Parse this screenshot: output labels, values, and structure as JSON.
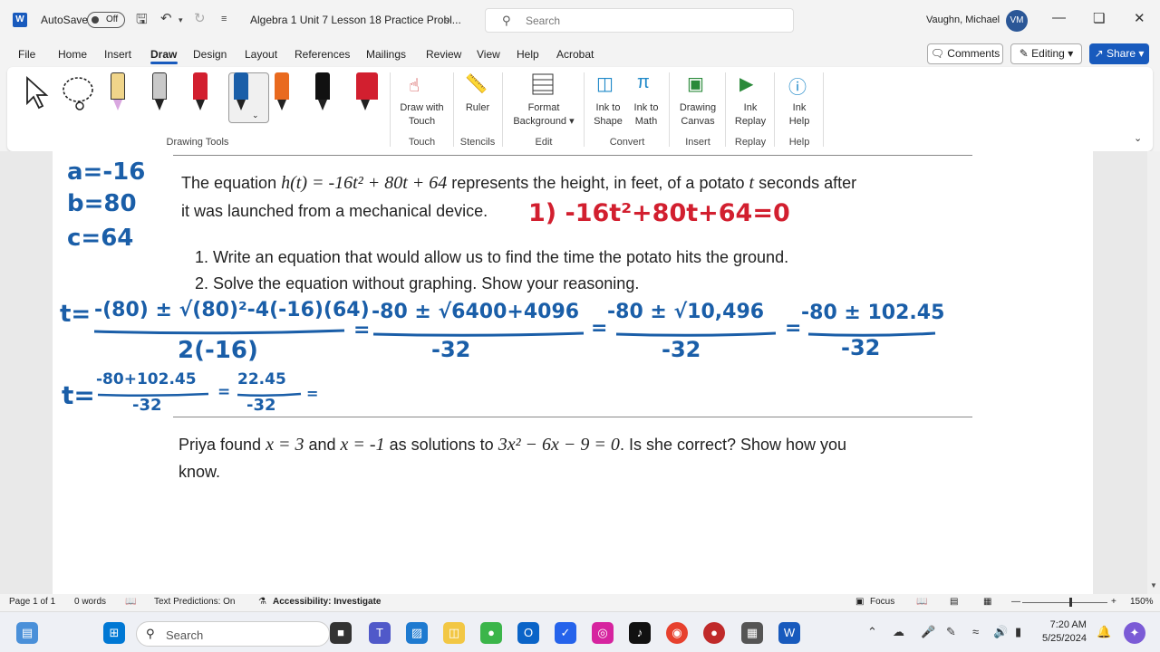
{
  "titlebar": {
    "autosave_label": "AutoSave",
    "autosave_state": "Off",
    "doc_title": "Algebra 1 Unit 7 Lesson 18 Practice Probl...",
    "search_placeholder": "Search",
    "user_name": "Vaughn, Michael",
    "user_initials": "VM"
  },
  "menu": {
    "items": [
      "File",
      "Home",
      "Insert",
      "Draw",
      "Design",
      "Layout",
      "References",
      "Mailings",
      "Review",
      "View",
      "Help",
      "Acrobat"
    ],
    "active": "Draw",
    "comments": "Comments",
    "editing": "Editing",
    "share": "Share"
  },
  "ribbon": {
    "drawing_tools_label": "Drawing Tools",
    "pen_colors": [
      "#f0d58a",
      "#c9c9c9",
      "#d21f2f",
      "#1a5ea8",
      "#e96a1f",
      "#111111",
      "#d21f2f"
    ],
    "buttons": [
      {
        "label1": "Draw with",
        "label2": "Touch",
        "group": "Touch"
      },
      {
        "label1": "Ruler",
        "label2": "",
        "group": "Stencils"
      },
      {
        "label1": "Format",
        "label2": "Background",
        "group": "Edit"
      },
      {
        "label1": "Ink to",
        "label2": "Shape",
        "group": "Convert"
      },
      {
        "label1": "Ink to",
        "label2": "Math",
        "group": ""
      },
      {
        "label1": "Drawing",
        "label2": "Canvas",
        "group": "Insert"
      },
      {
        "label1": "Ink",
        "label2": "Replay",
        "group": "Replay"
      },
      {
        "label1": "Ink",
        "label2": "Help",
        "group": "Help"
      }
    ]
  },
  "document": {
    "q1_prefix": "The equation",
    "q1_eq": "h(t) = -16t² + 80t + 64",
    "q1_suffix": "represents the height, in feet, of a potato",
    "q1_t": "t",
    "q1_suffix2": "seconds after",
    "q1_line2": "it was launched from a mechanical device.",
    "task1": "1. Write an equation that would allow us to find the time the potato hits the ground.",
    "task2": "2. Solve the equation without graphing. Show your reasoning.",
    "q2_prefix": "Priya found",
    "q2_x1": "x = 3",
    "q2_and": "and",
    "q2_x2": "x = -1",
    "q2_mid": "as solutions to",
    "q2_eq": "3x² − 6x − 9 = 0",
    "q2_suffix": ". Is she correct? Show how you",
    "q2_line2": "know."
  },
  "handwriting": {
    "a": "a=-16",
    "b": "b=80",
    "c": "c=64",
    "eq1": "1) -16t²+80t+64=0",
    "t_eq": "t=",
    "num1": "-(80) ± √(80)²-4(-16)(64)",
    "den1": "2(-16)",
    "num2": "-80 ± √6400+4096",
    "den2": "-32",
    "num3": "-80 ± √10,496",
    "den3": "-32",
    "num4": "-80 ± 102.45",
    "den4": "-32",
    "t2": "t=",
    "num5": "-80+102.45",
    "den5": "-32",
    "num6": "22.45",
    "den6": "-32",
    "eqsign": "="
  },
  "status": {
    "page": "Page 1 of 1",
    "words": "0 words",
    "predictions": "Text Predictions: On",
    "accessibility": "Accessibility: Investigate",
    "focus": "Focus",
    "zoom": "150%"
  },
  "taskbar": {
    "search_placeholder": "Search",
    "time": "7:20 AM",
    "date": "5/25/2024"
  }
}
